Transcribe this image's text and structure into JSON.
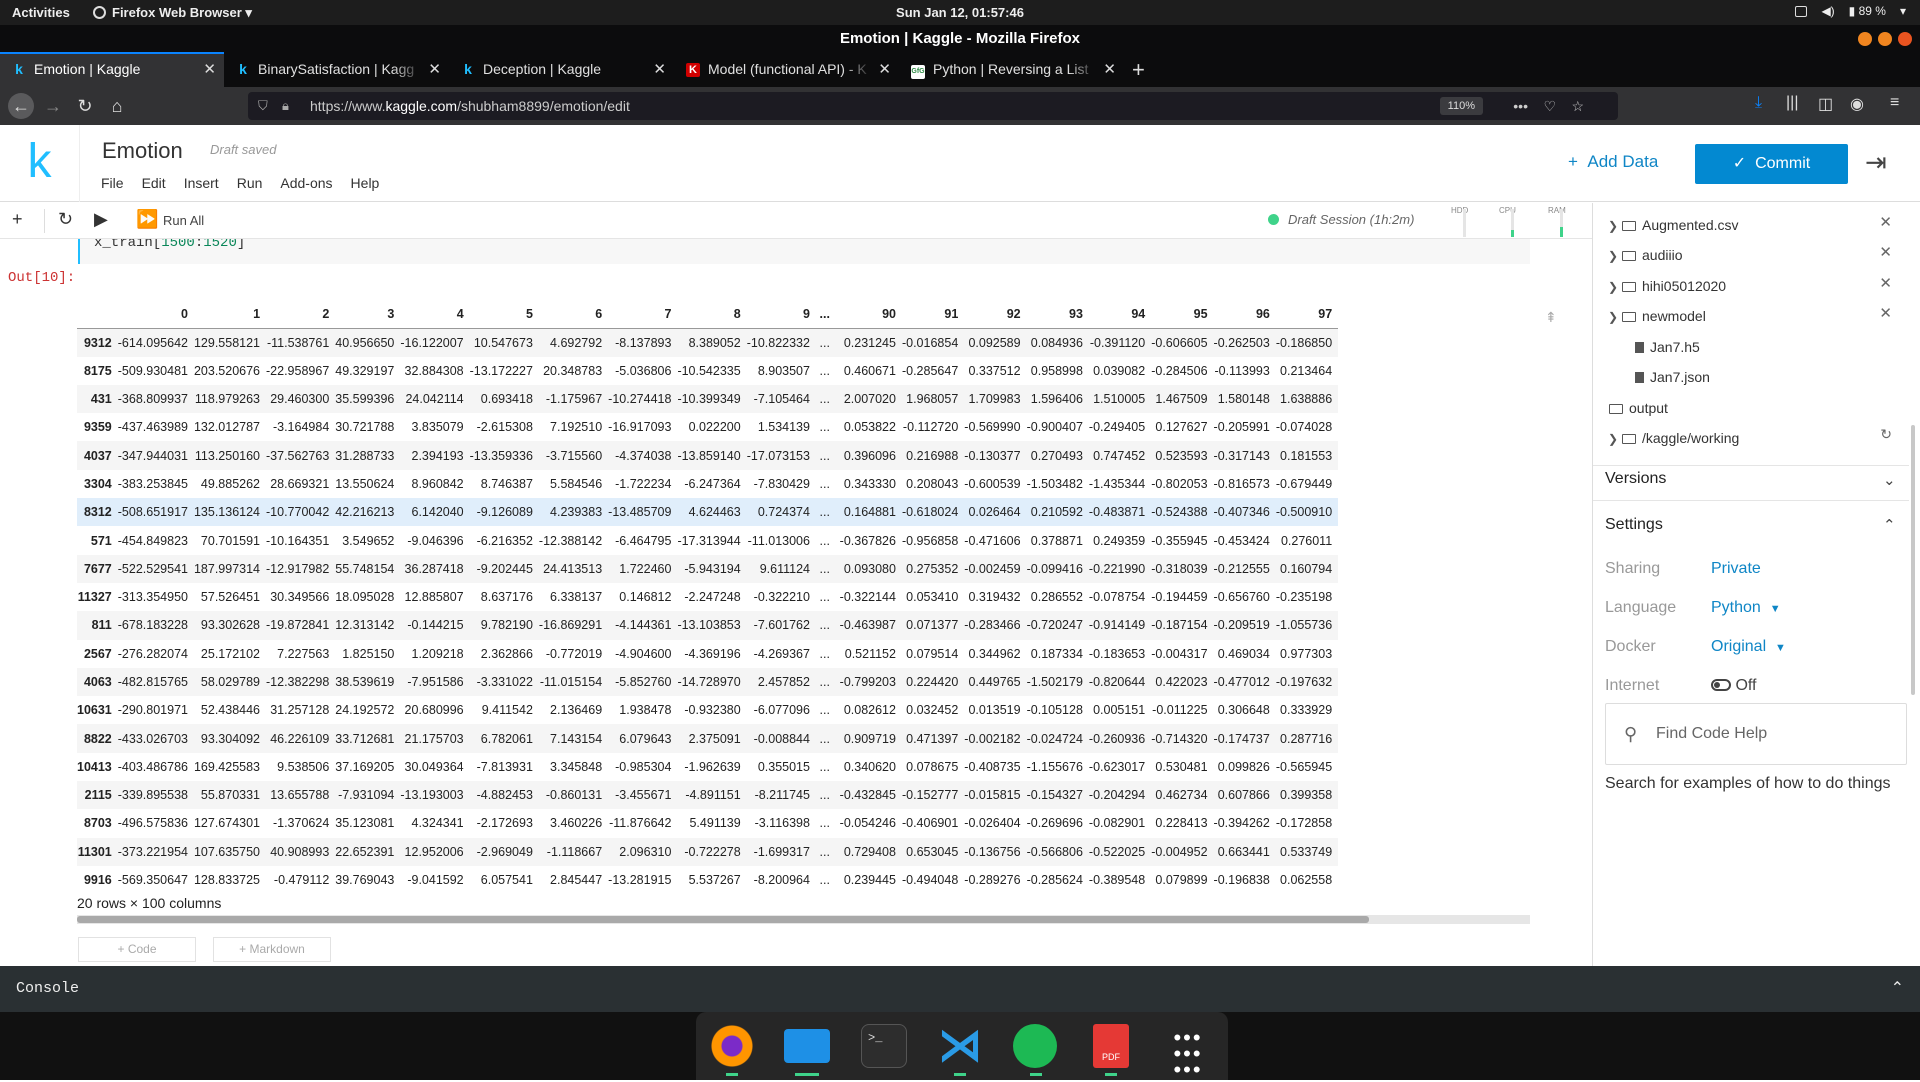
{
  "system": {
    "activities": "Activities",
    "app_menu": "Firefox Web Browser",
    "clock": "Sun Jan 12, 01:57:46",
    "battery": "89 %"
  },
  "browser": {
    "window_title": "Emotion | Kaggle - Mozilla Firefox",
    "tabs": [
      {
        "label": "Emotion | Kaggle",
        "favicon": "k"
      },
      {
        "label": "BinarySatisfaction | Kagg",
        "favicon": "k"
      },
      {
        "label": "Deception | Kaggle",
        "favicon": "k"
      },
      {
        "label": "Model (functional API) - K",
        "favicon": "K"
      },
      {
        "label": "Python | Reversing a List",
        "favicon": "GfG"
      }
    ],
    "url_prefix": "https://www.",
    "url_domain": "kaggle.com",
    "url_path": "/shubham8899/emotion/edit",
    "zoom": "110%"
  },
  "kaggle": {
    "logo": "k",
    "notebook_title": "Emotion",
    "draft_status": "Draft saved",
    "menu": [
      "File",
      "Edit",
      "Insert",
      "Run",
      "Add-ons",
      "Help"
    ],
    "add_data": "Add Data",
    "commit": "Commit"
  },
  "toolbar": {
    "run_all": "Run All",
    "session": "Draft Session (1h:2m)",
    "meters": [
      {
        "label": "HDD",
        "level": 0
      },
      {
        "label": "CPU",
        "level": 0.25
      },
      {
        "label": "RAM",
        "level": 0.35
      }
    ]
  },
  "cell": {
    "code_prefix": "x_train[",
    "code_a": "1500",
    "code_colon": ":",
    "code_b": "1520",
    "code_suffix": "]",
    "out_prompt": "Out[10]:"
  },
  "dataframe": {
    "columns": [
      "0",
      "1",
      "2",
      "3",
      "4",
      "5",
      "6",
      "7",
      "8",
      "9",
      "...",
      "90",
      "91",
      "92",
      "93",
      "94",
      "95",
      "96",
      "97"
    ],
    "highlighted_row": 6,
    "rows": [
      [
        "9312",
        "-614.095642",
        "129.558121",
        "-11.538761",
        "40.956650",
        "-16.122007",
        "10.547673",
        "4.692792",
        "-8.137893",
        "8.389052",
        "-10.822332",
        "...",
        "0.231245",
        "-0.016854",
        "0.092589",
        "0.084936",
        "-0.391120",
        "-0.606605",
        "-0.262503",
        "-0.186850"
      ],
      [
        "8175",
        "-509.930481",
        "203.520676",
        "-22.958967",
        "49.329197",
        "32.884308",
        "-13.172227",
        "20.348783",
        "-5.036806",
        "-10.542335",
        "8.903507",
        "...",
        "0.460671",
        "-0.285647",
        "0.337512",
        "0.958998",
        "0.039082",
        "-0.284506",
        "-0.113993",
        "0.213464"
      ],
      [
        "431",
        "-368.809937",
        "118.979263",
        "29.460300",
        "35.599396",
        "24.042114",
        "0.693418",
        "-1.175967",
        "-10.274418",
        "-10.399349",
        "-7.105464",
        "...",
        "2.007020",
        "1.968057",
        "1.709983",
        "1.596406",
        "1.510005",
        "1.467509",
        "1.580148",
        "1.638886"
      ],
      [
        "9359",
        "-437.463989",
        "132.012787",
        "-3.164984",
        "30.721788",
        "3.835079",
        "-2.615308",
        "7.192510",
        "-16.917093",
        "0.022200",
        "1.534139",
        "...",
        "0.053822",
        "-0.112720",
        "-0.569990",
        "-0.900407",
        "-0.249405",
        "0.127627",
        "-0.205991",
        "-0.074028"
      ],
      [
        "4037",
        "-347.944031",
        "113.250160",
        "-37.562763",
        "31.288733",
        "2.394193",
        "-13.359336",
        "-3.715560",
        "-4.374038",
        "-13.859140",
        "-17.073153",
        "...",
        "0.396096",
        "0.216988",
        "-0.130377",
        "0.270493",
        "0.747452",
        "0.523593",
        "-0.317143",
        "0.181553"
      ],
      [
        "3304",
        "-383.253845",
        "49.885262",
        "28.669321",
        "13.550624",
        "8.960842",
        "8.746387",
        "5.584546",
        "-1.722234",
        "-6.247364",
        "-7.830429",
        "...",
        "0.343330",
        "0.208043",
        "-0.600539",
        "-1.503482",
        "-1.435344",
        "-0.802053",
        "-0.816573",
        "-0.679449"
      ],
      [
        "8312",
        "-508.651917",
        "135.136124",
        "-10.770042",
        "42.216213",
        "6.142040",
        "-9.126089",
        "4.239383",
        "-13.485709",
        "4.624463",
        "0.724374",
        "...",
        "0.164881",
        "-0.618024",
        "0.026464",
        "0.210592",
        "-0.483871",
        "-0.524388",
        "-0.407346",
        "-0.500910"
      ],
      [
        "571",
        "-454.849823",
        "70.701591",
        "-10.164351",
        "3.549652",
        "-9.046396",
        "-6.216352",
        "-12.388142",
        "-6.464795",
        "-17.313944",
        "-11.013006",
        "...",
        "-0.367826",
        "-0.956858",
        "-0.471606",
        "0.378871",
        "0.249359",
        "-0.355945",
        "-0.453424",
        "0.276011"
      ],
      [
        "7677",
        "-522.529541",
        "187.997314",
        "-12.917982",
        "55.748154",
        "36.287418",
        "-9.202445",
        "24.413513",
        "1.722460",
        "-5.943194",
        "9.611124",
        "...",
        "0.093080",
        "0.275352",
        "-0.002459",
        "-0.099416",
        "-0.221990",
        "-0.318039",
        "-0.212555",
        "0.160794"
      ],
      [
        "11327",
        "-313.354950",
        "57.526451",
        "30.349566",
        "18.095028",
        "12.885807",
        "8.637176",
        "6.338137",
        "0.146812",
        "-2.247248",
        "-0.322210",
        "...",
        "-0.322144",
        "0.053410",
        "0.319432",
        "0.286552",
        "-0.078754",
        "-0.194459",
        "-0.656760",
        "-0.235198"
      ],
      [
        "811",
        "-678.183228",
        "93.302628",
        "-19.872841",
        "12.313142",
        "-0.144215",
        "9.782190",
        "-16.869291",
        "-4.144361",
        "-13.103853",
        "-7.601762",
        "...",
        "-0.463987",
        "0.071377",
        "-0.283466",
        "-0.720247",
        "-0.914149",
        "-0.187154",
        "-0.209519",
        "-1.055736"
      ],
      [
        "2567",
        "-276.282074",
        "25.172102",
        "7.227563",
        "1.825150",
        "1.209218",
        "2.362866",
        "-0.772019",
        "-4.904600",
        "-4.369196",
        "-4.269367",
        "...",
        "0.521152",
        "0.079514",
        "0.344962",
        "0.187334",
        "-0.183653",
        "-0.004317",
        "0.469034",
        "0.977303"
      ],
      [
        "4063",
        "-482.815765",
        "58.029789",
        "-12.382298",
        "38.539619",
        "-7.951586",
        "-3.331022",
        "-11.015154",
        "-5.852760",
        "-14.728970",
        "2.457852",
        "...",
        "-0.799203",
        "0.224420",
        "0.449765",
        "-1.502179",
        "-0.820644",
        "0.422023",
        "-0.477012",
        "-0.197632"
      ],
      [
        "10631",
        "-290.801971",
        "52.438446",
        "31.257128",
        "24.192572",
        "20.680996",
        "9.411542",
        "2.136469",
        "1.938478",
        "-0.932380",
        "-6.077096",
        "...",
        "0.082612",
        "0.032452",
        "0.013519",
        "-0.105128",
        "0.005151",
        "-0.011225",
        "0.306648",
        "0.333929"
      ],
      [
        "8822",
        "-433.026703",
        "93.304092",
        "46.226109",
        "33.712681",
        "21.175703",
        "6.782061",
        "7.143154",
        "6.079643",
        "2.375091",
        "-0.008844",
        "...",
        "0.909719",
        "0.471397",
        "-0.002182",
        "-0.024724",
        "-0.260936",
        "-0.714320",
        "-0.174737",
        "0.287716"
      ],
      [
        "10413",
        "-403.486786",
        "169.425583",
        "9.538506",
        "37.169205",
        "30.049364",
        "-7.813931",
        "3.345848",
        "-0.985304",
        "-1.962639",
        "0.355015",
        "...",
        "0.340620",
        "0.078675",
        "-0.408735",
        "-1.155676",
        "-0.623017",
        "0.530481",
        "0.099826",
        "-0.565945"
      ],
      [
        "2115",
        "-339.895538",
        "55.870331",
        "13.655788",
        "-7.931094",
        "-13.193003",
        "-4.882453",
        "-0.860131",
        "-3.455671",
        "-4.891151",
        "-8.211745",
        "...",
        "-0.432845",
        "-0.152777",
        "-0.015815",
        "-0.154327",
        "-0.204294",
        "0.462734",
        "0.607866",
        "0.399358"
      ],
      [
        "8703",
        "-496.575836",
        "127.674301",
        "-1.370624",
        "35.123081",
        "4.324341",
        "-2.172693",
        "3.460226",
        "-11.876642",
        "5.491139",
        "-3.116398",
        "...",
        "-0.054246",
        "-0.406901",
        "-0.026404",
        "-0.269696",
        "-0.082901",
        "0.228413",
        "-0.394262",
        "-0.172858"
      ],
      [
        "11301",
        "-373.221954",
        "107.635750",
        "40.908993",
        "22.652391",
        "12.952006",
        "-2.969049",
        "-1.118667",
        "2.096310",
        "-0.722278",
        "-1.699317",
        "...",
        "0.729408",
        "0.653045",
        "-0.136756",
        "-0.566806",
        "-0.522025",
        "-0.004952",
        "0.663441",
        "0.533749"
      ],
      [
        "9916",
        "-569.350647",
        "128.833725",
        "-0.479112",
        "39.769043",
        "-9.041592",
        "6.057541",
        "2.845447",
        "-13.281915",
        "5.537267",
        "-8.200964",
        "...",
        "0.239445",
        "-0.494048",
        "-0.289276",
        "-0.285624",
        "-0.389548",
        "0.079899",
        "-0.196838",
        "0.062558"
      ]
    ],
    "summary": "20 rows × 100 columns"
  },
  "add_cell": {
    "code": "+ Code",
    "markdown": "+ Markdown"
  },
  "sidebar": {
    "tree": [
      {
        "label": "Augmented.csv",
        "type": "folder",
        "expandable": true,
        "removable": true
      },
      {
        "label": "audiiio",
        "type": "folder",
        "expandable": true,
        "removable": true
      },
      {
        "label": "hihi05012020",
        "type": "folder",
        "expandable": true,
        "removable": true
      },
      {
        "label": "newmodel",
        "type": "folder",
        "expanded": true,
        "removable": true
      },
      {
        "label": "Jan7.h5",
        "type": "file"
      },
      {
        "label": "Jan7.json",
        "type": "file"
      },
      {
        "label": "output",
        "type": "folder"
      },
      {
        "label": "/kaggle/working",
        "type": "folder",
        "expandable": true
      }
    ],
    "versions": "Versions",
    "settings": "Settings",
    "sharing_label": "Sharing",
    "sharing_value": "Private",
    "language_label": "Language",
    "language_value": "Python",
    "docker_label": "Docker",
    "docker_value": "Original",
    "internet_label": "Internet",
    "internet_value": "Off",
    "find_placeholder": "Find Code Help",
    "find_hint": "Search for examples of how to do things"
  },
  "console": {
    "label": "Console"
  },
  "dock": {
    "apps": [
      "Firefox",
      "Files",
      "Terminal",
      "Visual Studio Code",
      "Spotify",
      "PDF Viewer",
      "Show Applications"
    ]
  },
  "colors": {
    "kaggle_blue": "#20beff",
    "commit_blue": "#0389d1",
    "link_blue": "#0f86c6",
    "session_green": "#3fd38a",
    "out_red": "#cc3333"
  }
}
